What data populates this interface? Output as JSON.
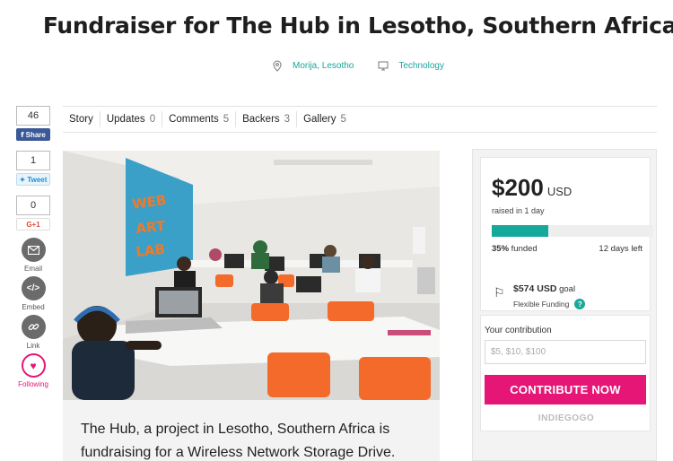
{
  "title": "Fundraiser for The Hub in Lesotho, Southern Africa",
  "meta": {
    "location": "Morija, Lesotho",
    "category": "Technology"
  },
  "social": {
    "facebook_count": "46",
    "facebook_label": "Share",
    "twitter_count": "1",
    "twitter_label": "Tweet",
    "google_count": "0",
    "google_label": "G+1",
    "email_label": "Email",
    "embed_label": "Embed",
    "link_label": "Link",
    "following_label": "Following"
  },
  "tabs": [
    {
      "label": "Story",
      "count": ""
    },
    {
      "label": "Updates",
      "count": "0"
    },
    {
      "label": "Comments",
      "count": "5"
    },
    {
      "label": "Backers",
      "count": "3"
    },
    {
      "label": "Gallery",
      "count": "5"
    }
  ],
  "story": {
    "text": "The Hub, a project in Lesotho, Southern Africa is fundraising for a Wireless Network Storage Drive."
  },
  "campaign": {
    "amount": "$200",
    "currency": "USD",
    "raised_text": "raised in 1 day",
    "percent_funded": 35,
    "percent_label": "35%",
    "funded_word": "funded",
    "days_left": "12 days left",
    "goal_amount": "$574 USD",
    "goal_word": "goal",
    "funding_type": "Flexible Funding"
  },
  "contribution": {
    "label": "Your contribution",
    "placeholder": "$5, $10, $100",
    "button": "CONTRIBUTE NOW",
    "brand": "INDIEGOGO"
  },
  "colors": {
    "accent_teal": "#16a99b",
    "accent_pink": "#e51675",
    "facebook": "#3b5998"
  }
}
